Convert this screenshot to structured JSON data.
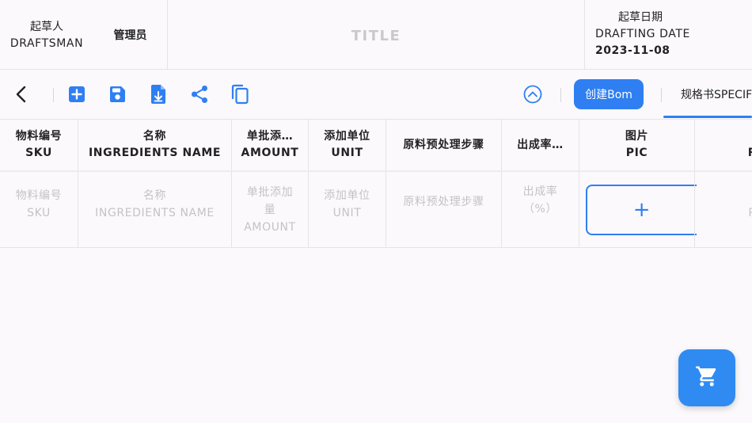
{
  "header": {
    "draftsman_cn": "起草人",
    "draftsman_en": "DRAFTSMAN",
    "draftsman_value": "管理员",
    "title": "TITLE",
    "drafting_date_cn": "起草日期",
    "drafting_date_en": "DRAFTING DATE",
    "drafting_date_value": "2023-11-08"
  },
  "toolbar": {
    "icons": [
      "back-icon",
      "add-icon",
      "save-icon",
      "download-file-icon",
      "share-icon",
      "copy-icon",
      "collapse-up-icon"
    ],
    "create_bom_label": "创建Bom",
    "spec_tab_label": "规格书SPECIFICATION",
    "accent_color": "#2f7ff2"
  },
  "table": {
    "headers": [
      {
        "cn": "物料编号",
        "en": "SKU"
      },
      {
        "cn": "名称",
        "en": "INGREDIENTS NAME"
      },
      {
        "cn": "单批添…",
        "en": "AMOUNT"
      },
      {
        "cn": "添加单位",
        "en": "UNIT"
      },
      {
        "cn": "原料预处理步骤",
        "en": ""
      },
      {
        "cn": "出成率…",
        "en": ""
      },
      {
        "cn": "图片",
        "en": "PIC"
      },
      {
        "cn": "",
        "en": "R"
      }
    ],
    "placeholder_row": [
      {
        "l1": "物料编号",
        "l2": "SKU",
        "l3": ""
      },
      {
        "l1": "名称",
        "l2": "INGREDIENTS NAME",
        "l3": ""
      },
      {
        "l1": "单批添加",
        "l2": "量",
        "l3": "AMOUNT"
      },
      {
        "l1": "添加单位",
        "l2": "UNIT",
        "l3": ""
      },
      {
        "l1": "原料预处理步骤",
        "l2": "",
        "l3": ""
      },
      {
        "l1": "出成率",
        "l2": "（%）",
        "l3": ""
      },
      {
        "l1": "+",
        "l2": "",
        "l3": ""
      },
      {
        "l1": "",
        "l2": "R",
        "l3": ""
      }
    ]
  },
  "fab": {
    "icon": "cart-icon",
    "color": "#2f8bf2"
  }
}
